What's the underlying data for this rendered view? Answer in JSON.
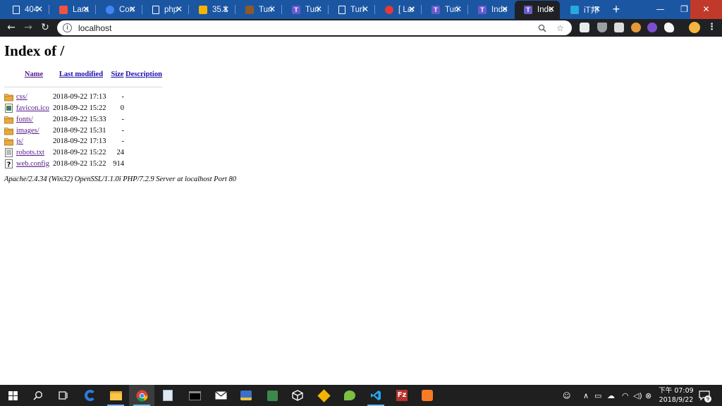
{
  "browser": {
    "tabs": [
      {
        "title": "404",
        "favicon": "page-icon",
        "color": "#ffffff"
      },
      {
        "title": "Lara",
        "favicon": "laravel-icon",
        "color": "#f05340"
      },
      {
        "title": "Con",
        "favicon": "chrome-icon",
        "color": "#4285f4"
      },
      {
        "title": "php",
        "favicon": "page-icon",
        "color": "#ffffff"
      },
      {
        "title": "35.1",
        "favicon": "image-icon",
        "color": "#f4b400"
      },
      {
        "title": "Turi",
        "favicon": "book-icon",
        "color": "#8b5a2b"
      },
      {
        "title": "Turi",
        "favicon": "t-icon",
        "color": "#6a5acd"
      },
      {
        "title": "Turi",
        "favicon": "page-icon",
        "color": "#ffffff"
      },
      {
        "title": "[ Lar",
        "favicon": "pokeball-icon",
        "color": "#e53935"
      },
      {
        "title": "Turi",
        "favicon": "t-icon",
        "color": "#6a5acd"
      },
      {
        "title": "Inde",
        "favicon": "t-icon",
        "color": "#6a5acd"
      },
      {
        "title": "Inde",
        "favicon": "t-icon",
        "color": "#6a5acd",
        "active": true
      },
      {
        "title": "iT邦",
        "favicon": "ithome-icon",
        "color": "#29a8e0"
      }
    ],
    "new_tab_label": "+",
    "window_controls": {
      "minimize": "—",
      "maximize": "❐",
      "close": "✕"
    },
    "url": "localhost",
    "nav": {
      "back": "←",
      "forward": "→",
      "reload": "↻"
    },
    "omnibox_icons": {
      "zoom": "search-icon",
      "bookmark": "☆"
    },
    "menu": "⋮"
  },
  "page": {
    "title": "Index of /",
    "columns": {
      "name": "Name",
      "last_modified": "Last modified",
      "size": "Size",
      "description": "Description"
    },
    "entries": [
      {
        "name": "css/",
        "icon": "folder-icon",
        "modified": "2018-09-22 17:13",
        "size": "-"
      },
      {
        "name": "favicon.ico",
        "icon": "image-file-icon",
        "modified": "2018-09-22 15:22",
        "size": "0"
      },
      {
        "name": "fonts/",
        "icon": "folder-icon",
        "modified": "2018-09-22 15:33",
        "size": "-"
      },
      {
        "name": "images/",
        "icon": "folder-icon",
        "modified": "2018-09-22 15:31",
        "size": "-"
      },
      {
        "name": "js/",
        "icon": "folder-icon",
        "modified": "2018-09-22 17:13",
        "size": "-"
      },
      {
        "name": "robots.txt",
        "icon": "text-file-icon",
        "modified": "2018-09-22 15:22",
        "size": "24"
      },
      {
        "name": "web.config",
        "icon": "unknown-file-icon",
        "modified": "2018-09-22 15:22",
        "size": "914"
      }
    ],
    "server_signature": "Apache/2.4.34 (Win32) OpenSSL/1.1.0i PHP/7.2.9 Server at localhost Port 80"
  },
  "taskbar": {
    "clock_time": "下午 07:09",
    "clock_date": "2018/9/22",
    "notification_count": "9",
    "colors": {
      "background": "#1f1f1f",
      "accent": "#76b9ed"
    }
  }
}
